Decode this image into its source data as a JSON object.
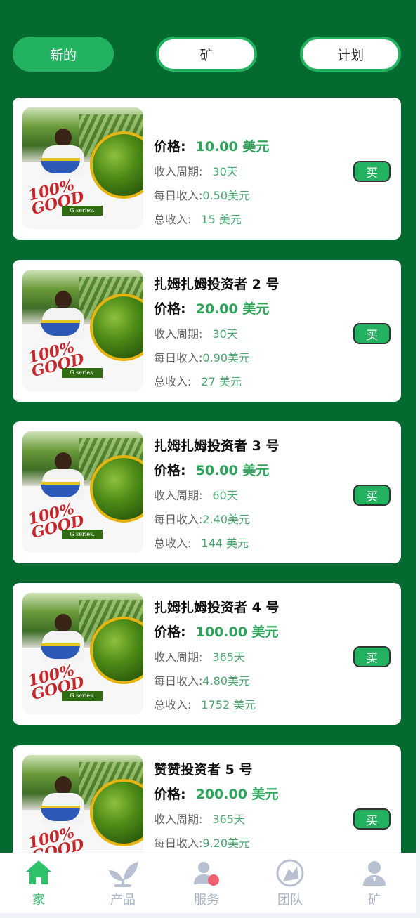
{
  "tabs": [
    {
      "label": "新的",
      "active": true
    },
    {
      "label": "矿",
      "active": false
    },
    {
      "label": "计划",
      "active": false
    }
  ],
  "product_image": {
    "badge_text": "100% GOOD",
    "series_text": "G series."
  },
  "cards": [
    {
      "title": "",
      "price_label": "价格:",
      "price": "10.00 美元",
      "period_label": "收入周期:",
      "period": "30天",
      "daily_label": "每日收入:",
      "daily": "0.50美元",
      "total_label": "总收入:",
      "total": "15 美元",
      "buy_label": "买"
    },
    {
      "title": "扎姆扎姆投资者 2 号",
      "price_label": "价格:",
      "price": "20.00 美元",
      "period_label": "收入周期:",
      "period": "30天",
      "daily_label": "每日收入:",
      "daily": "0.90美元",
      "total_label": "总收入:",
      "total": "27 美元",
      "buy_label": "买"
    },
    {
      "title": "扎姆扎姆投资者 3 号",
      "price_label": "价格:",
      "price": "50.00 美元",
      "period_label": "收入周期:",
      "period": "60天",
      "daily_label": "每日收入:",
      "daily": "2.40美元",
      "total_label": "总收入:",
      "total": "144 美元",
      "buy_label": "买"
    },
    {
      "title": "扎姆扎姆投资者 4 号",
      "price_label": "价格:",
      "price": "100.00 美元",
      "period_label": "收入周期:",
      "period": "365天",
      "daily_label": "每日收入:",
      "daily": "4.80美元",
      "total_label": "总收入:",
      "total": "1752 美元",
      "buy_label": "买"
    },
    {
      "title": "赞赞投资者 5 号",
      "price_label": "价格:",
      "price": "200.00 美元",
      "period_label": "收入周期:",
      "period": "365天",
      "daily_label": "每日收入:",
      "daily": "9.20美元",
      "total_label": "",
      "total": "",
      "buy_label": "买"
    }
  ],
  "bottom_nav": [
    {
      "label": "家",
      "icon": "home-icon",
      "active": true
    },
    {
      "label": "产品",
      "icon": "sprout-icon",
      "active": false
    },
    {
      "label": "服务",
      "icon": "user-service-icon",
      "active": false
    },
    {
      "label": "团队",
      "icon": "team-icon",
      "active": false
    },
    {
      "label": "矿",
      "icon": "mine-user-icon",
      "active": false
    }
  ],
  "colors": {
    "background": "#046a30",
    "accent": "#23b25f",
    "price": "#2da45a",
    "nav_inactive": "#a9b4c5"
  }
}
